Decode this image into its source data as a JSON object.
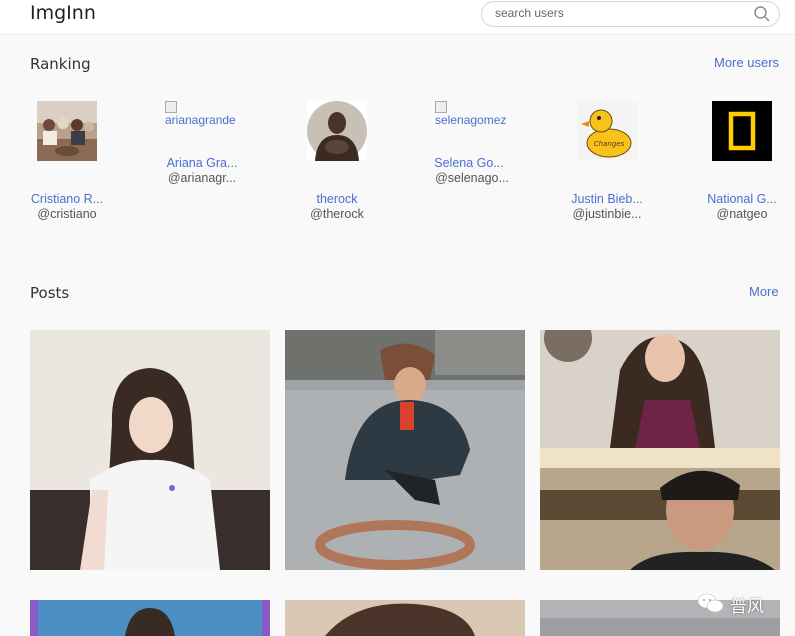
{
  "header": {
    "logo": "ImgInn",
    "search_placeholder": "search users"
  },
  "ranking": {
    "title": "Ranking",
    "more_label": "More users",
    "users": [
      {
        "name": "Cristiano R...",
        "handle": "@cristiano",
        "alt": ""
      },
      {
        "name": "Ariana Gra...",
        "handle": "@arianagr...",
        "alt": "arianagrande"
      },
      {
        "name": "therock",
        "handle": "@therock",
        "alt": ""
      },
      {
        "name": "Selena Go...",
        "handle": "@selenago...",
        "alt": "selenagomez"
      },
      {
        "name": "Justin Bieb...",
        "handle": "@justinbie...",
        "alt": ""
      },
      {
        "name": "National G...",
        "handle": "@natgeo",
        "alt": ""
      }
    ]
  },
  "posts": {
    "title": "Posts",
    "more_label": "More"
  },
  "watermark": {
    "text": "普风"
  },
  "colors": {
    "link": "#4a6fd0",
    "natgeo_yellow": "#ffcc00"
  }
}
